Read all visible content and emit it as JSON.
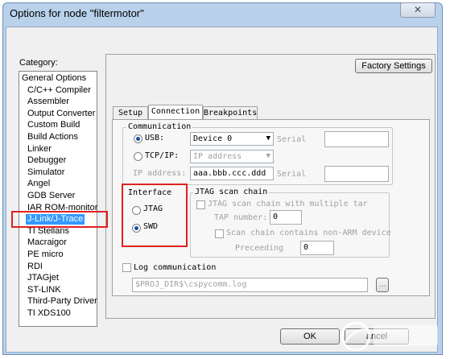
{
  "window": {
    "title": "Options for node \"filtermotor\"",
    "close_label": "✕"
  },
  "category": {
    "label": "Category:",
    "items": [
      {
        "label": "General Options",
        "indent": false
      },
      {
        "label": "C/C++ Compiler",
        "indent": true
      },
      {
        "label": "Assembler",
        "indent": true
      },
      {
        "label": "Output Converter",
        "indent": true
      },
      {
        "label": "Custom Build",
        "indent": true
      },
      {
        "label": "Build Actions",
        "indent": true
      },
      {
        "label": "Linker",
        "indent": true
      },
      {
        "label": "Debugger",
        "indent": true
      },
      {
        "label": "Simulator",
        "indent": true
      },
      {
        "label": "Angel",
        "indent": true
      },
      {
        "label": "GDB Server",
        "indent": true
      },
      {
        "label": "IAR ROM-monitor",
        "indent": true
      },
      {
        "label": "J-Link/J-Trace",
        "indent": true,
        "selected": true
      },
      {
        "label": "TI Stellaris",
        "indent": true
      },
      {
        "label": "Macraigor",
        "indent": true
      },
      {
        "label": "PE micro",
        "indent": true
      },
      {
        "label": "RDI",
        "indent": true
      },
      {
        "label": "JTAGjet",
        "indent": true
      },
      {
        "label": "ST-LINK",
        "indent": true
      },
      {
        "label": "Third-Party Driver",
        "indent": true
      },
      {
        "label": "TI XDS100",
        "indent": true
      }
    ]
  },
  "factory_settings_label": "Factory Settings",
  "tabs": [
    "Setup",
    "Connection",
    "Breakpoints"
  ],
  "active_tab": "Connection",
  "communication": {
    "title": "Communication",
    "usb_label": "USB:",
    "usb_value": "Device 0",
    "usb_selected": true,
    "serial_label": "Serial",
    "tcpip_label": "TCP/IP:",
    "tcpip_value": "IP address",
    "ip_address_label": "IP address:",
    "ip_address_value": "aaa.bbb.ccc.ddd",
    "serial2_label": "Serial"
  },
  "interface": {
    "title": "Interface",
    "jtag_label": "JTAG",
    "swd_label": "SWD",
    "selected": "SWD"
  },
  "jtag_chain": {
    "title": "JTAG scan chain",
    "multi_label": "JTAG scan chain with multiple tar",
    "tap_label": "TAP number:",
    "tap_value": "0",
    "non_arm_label": "Scan chain contains non-ARM device",
    "preceeding_label": "Preceeding",
    "preceeding_value": "0"
  },
  "log": {
    "label": "Log communication",
    "path": "$PROJ_DIR$\\cspycomm.log",
    "browse_label": "..."
  },
  "buttons": {
    "ok": "OK",
    "cancel": "ancel"
  },
  "colors": {
    "highlight": "#e02020",
    "selection": "#3399ff",
    "radio_dot": "#1d4fa8"
  }
}
